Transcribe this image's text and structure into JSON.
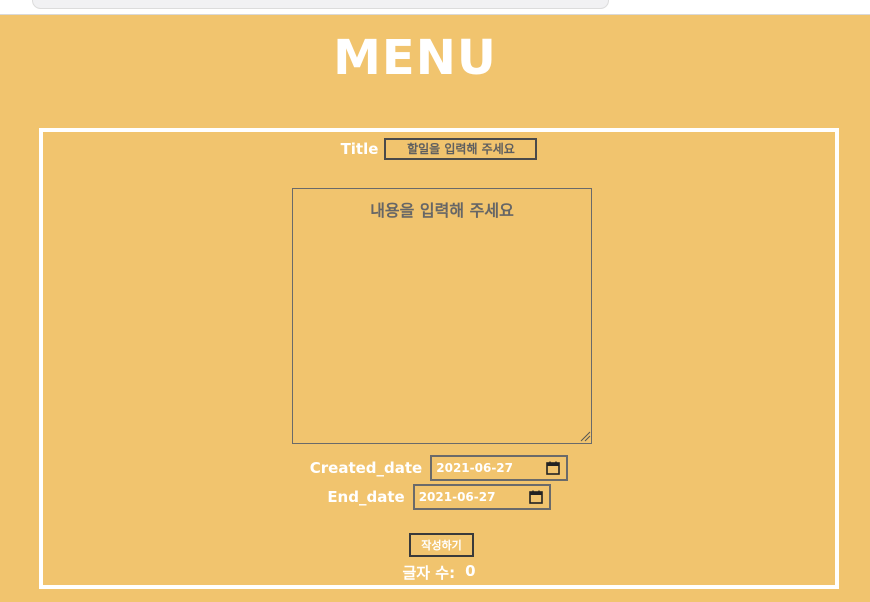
{
  "page": {
    "title": "MENU"
  },
  "form": {
    "title_label": "Title",
    "title_placeholder": "할일을 입력해 주세요",
    "content_placeholder": "내용을 입력해 주세요",
    "created_label": "Created_date",
    "created_value": "2021-06-27",
    "end_label": "End_date",
    "end_value": "2021-06-27",
    "submit_label": "작성하기",
    "count_label": "글자 수:",
    "count_value": "0"
  },
  "icons": {
    "calendar": "calendar-icon",
    "resize": "resize-grip-icon"
  },
  "colors": {
    "background": "#f1c46e",
    "text": "#ffffff",
    "border": "#ffffff"
  }
}
